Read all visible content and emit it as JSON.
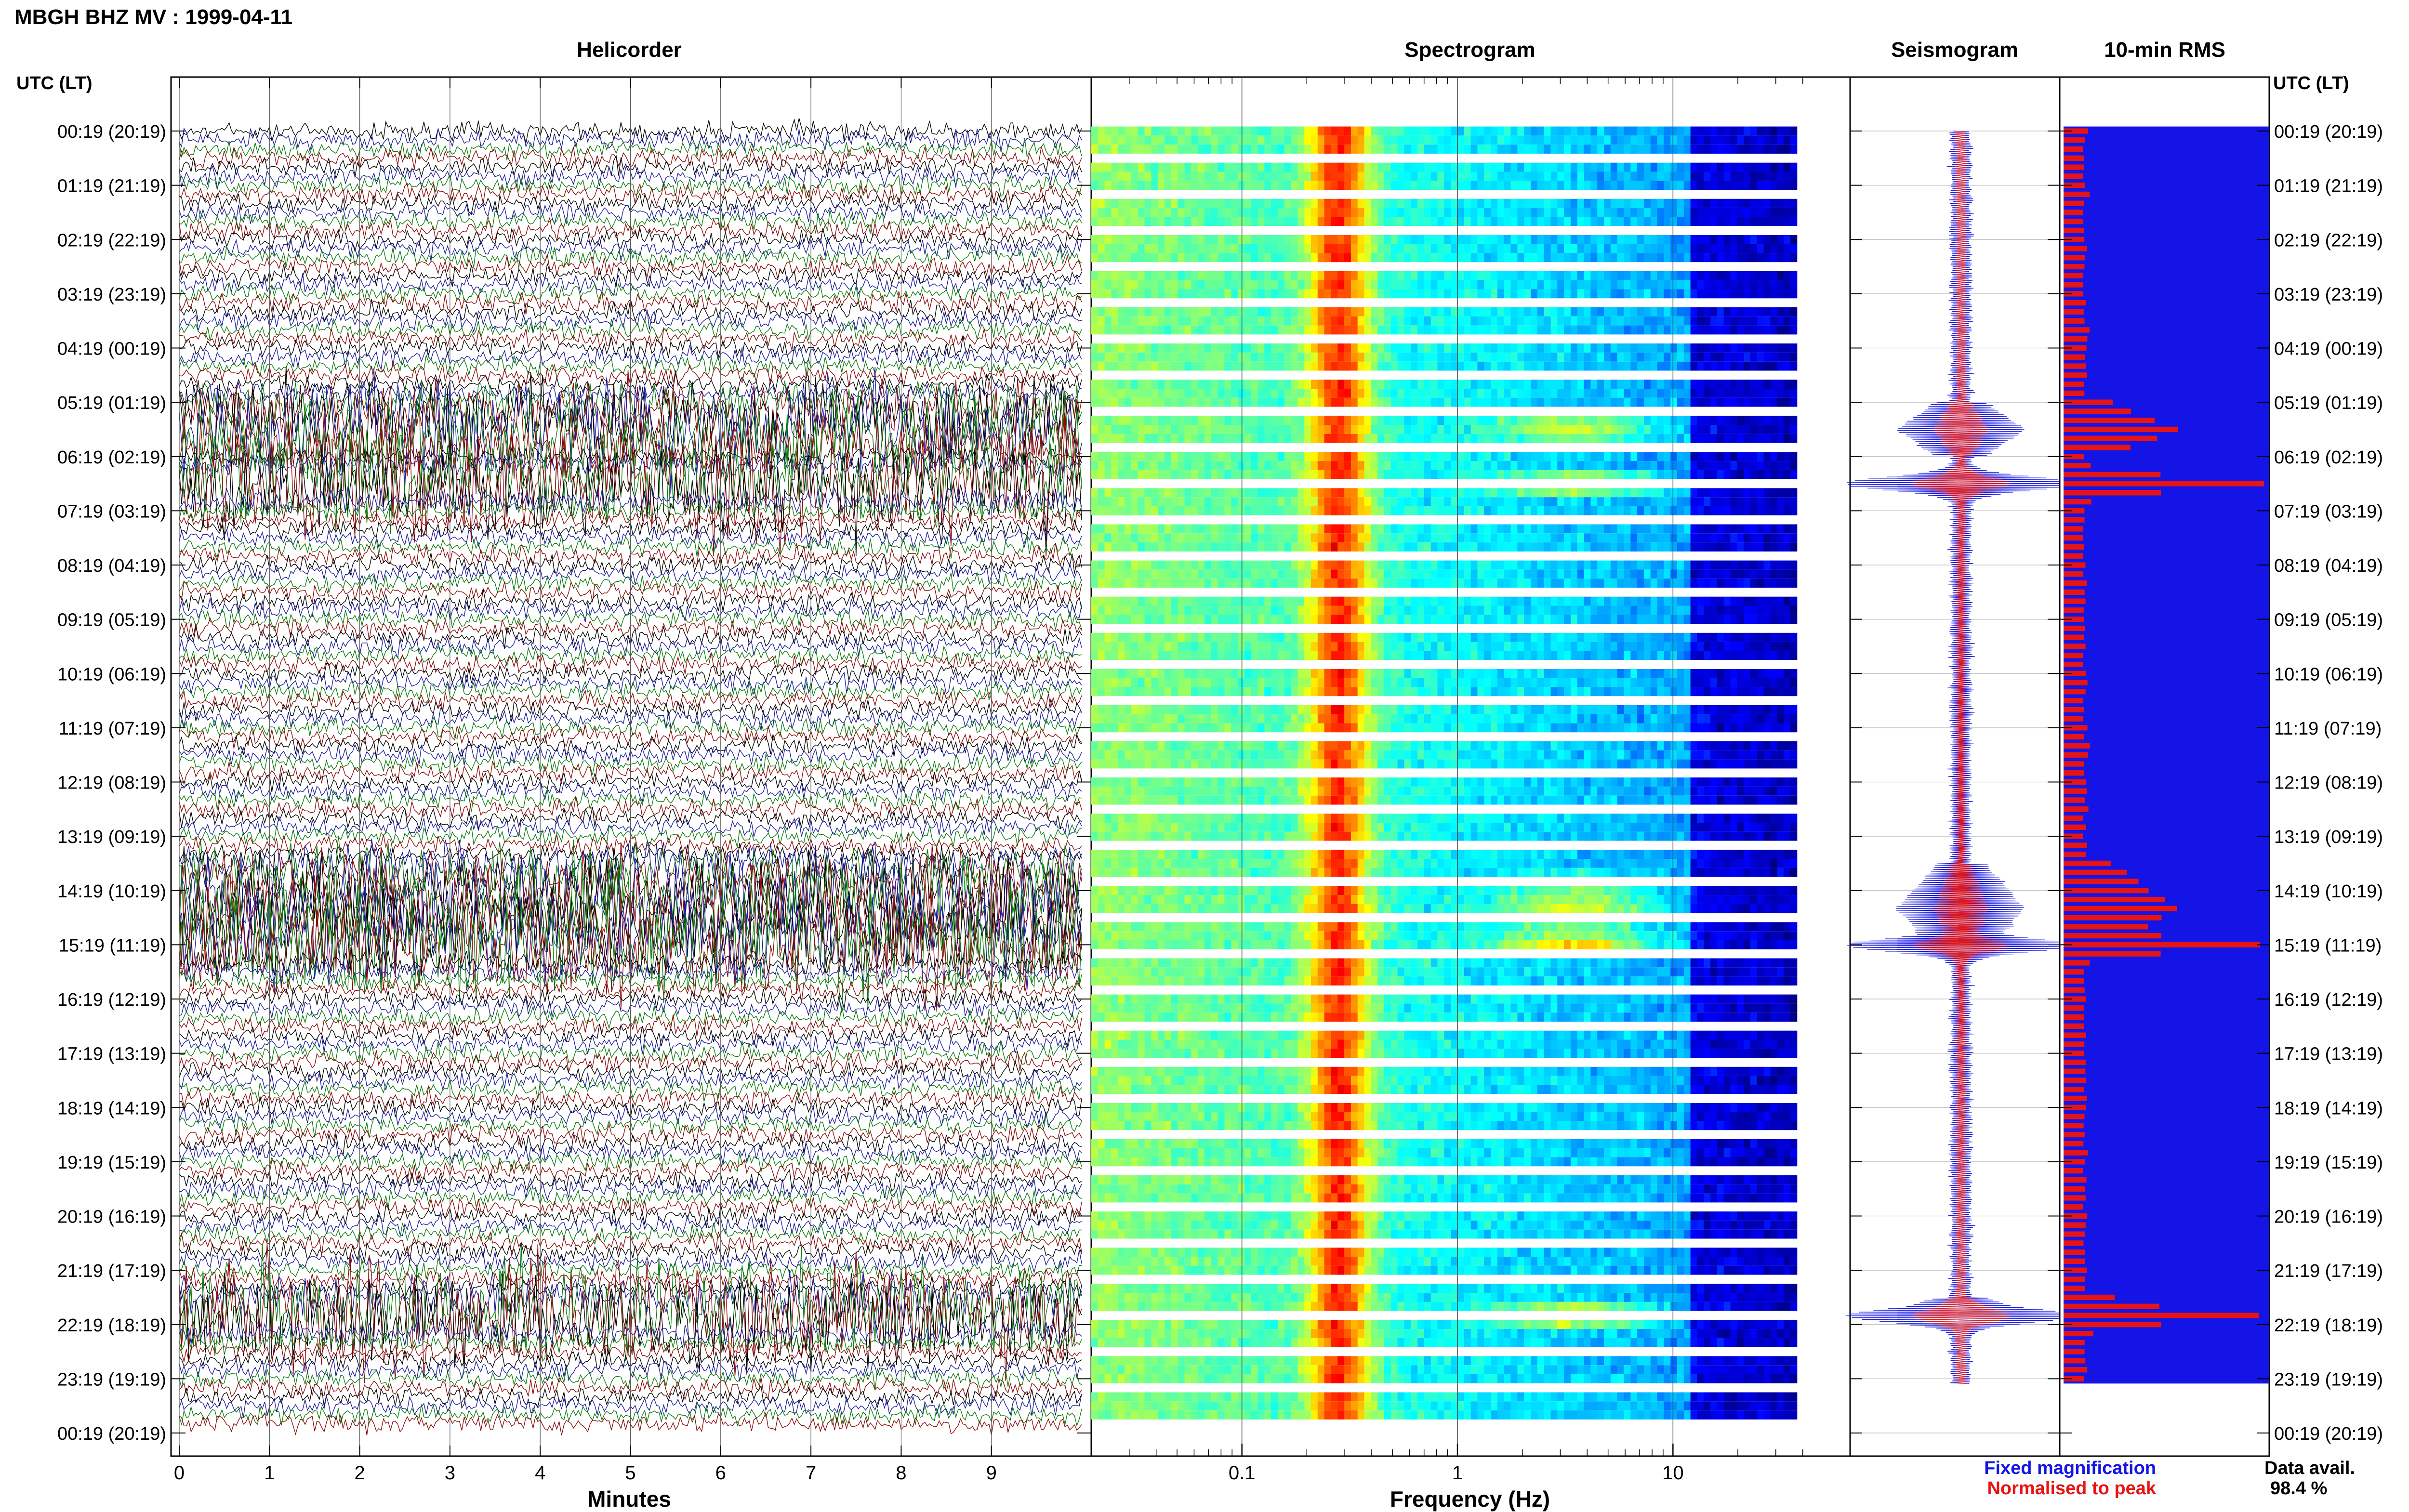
{
  "page_title": "MBGH BHZ MV : 1999-04-11",
  "time_axis_header_left": "UTC (LT)",
  "time_axis_header_right": "UTC (LT)",
  "time_ticks": [
    "00:19 (20:19)",
    "01:19 (21:19)",
    "02:19 (22:19)",
    "03:19 (23:19)",
    "04:19 (00:19)",
    "05:19 (01:19)",
    "06:19 (02:19)",
    "07:19 (03:19)",
    "08:19 (04:19)",
    "09:19 (05:19)",
    "10:19 (06:19)",
    "11:19 (07:19)",
    "12:19 (08:19)",
    "13:19 (09:19)",
    "14:19 (10:19)",
    "15:19 (11:19)",
    "16:19 (12:19)",
    "17:19 (13:19)",
    "18:19 (14:19)",
    "19:19 (15:19)",
    "20:19 (16:19)",
    "21:19 (17:19)",
    "22:19 (18:19)",
    "23:19 (19:19)",
    "00:19 (20:19)"
  ],
  "legend": {
    "fixed_label": "Fixed magnification",
    "fixed_color": "#1414e6",
    "norm_label": "Normalised to peak",
    "norm_color": "#e61414"
  },
  "data_availability": {
    "label": "Data avail.",
    "value": "98.4 %"
  },
  "colors": {
    "trace_cycle": [
      "#000000",
      "#1a1a9a",
      "#0a7a0a",
      "#8a0a0a"
    ],
    "seis_blue": "#1414e6",
    "seis_red": "#e61414",
    "rms_blue": "#1414e6",
    "rms_red": "#e61414"
  },
  "chart_data": [
    {
      "panel": "helicorder",
      "type": "line",
      "title": "Helicorder",
      "xlabel": "Minutes",
      "xlim": [
        0,
        10
      ],
      "x_ticks": [
        "0",
        "1",
        "2",
        "3",
        "4",
        "5",
        "6",
        "7",
        "8",
        "9"
      ],
      "y_ticks_utc_lt": "time_ticks",
      "rows": 144,
      "row_length_min": 10,
      "active_intervals": [
        {
          "from": "05:19",
          "to": "06:19",
          "description": "elevated amplitude"
        },
        {
          "from": "13:49",
          "to": "15:29",
          "description": "strong amplitude"
        },
        {
          "from": "21:49",
          "to": "22:19",
          "description": "elevated amplitude"
        }
      ]
    },
    {
      "panel": "spectrogram",
      "type": "heatmap",
      "title": "Spectrogram",
      "xlabel": "Frequency (Hz)",
      "xscale": "log",
      "xlim": [
        0.02,
        50
      ],
      "x_ticks": [
        "0.1",
        "1",
        "10"
      ],
      "x_tick_values": [
        0.1,
        1,
        10
      ],
      "dominant_band_hz": [
        0.2,
        0.4
      ],
      "colormap": "jet"
    },
    {
      "panel": "seismogram",
      "type": "line",
      "title": "Seismogram",
      "series": [
        {
          "name": "Fixed magnification",
          "color": "#1414e6"
        },
        {
          "name": "Normalised to peak",
          "color": "#e61414"
        }
      ],
      "peaks_at": [
        "06:49",
        "15:19",
        "22:09"
      ]
    },
    {
      "panel": "rms",
      "type": "bar",
      "title": "10-min RMS",
      "peaks_at": [
        "06:49",
        "15:19",
        "22:09"
      ]
    }
  ]
}
